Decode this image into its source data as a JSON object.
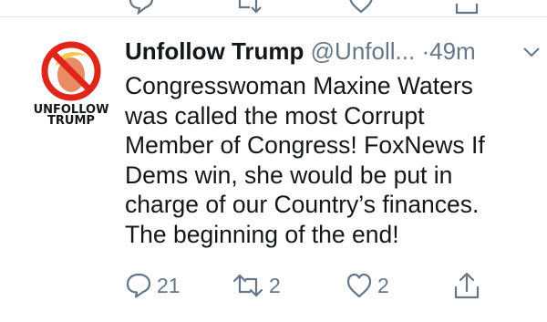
{
  "tweet": {
    "author_name": "Unfollow Trump",
    "handle": "@Unfoll...",
    "separator": "·",
    "time": "49m",
    "avatar_text_line1": "UNFOLLOW",
    "avatar_text_line2": "TRUMP",
    "text": "Congresswoman Maxine Waters\nwas called the most Corrupt\nMember of Congress! FoxNews If\nDems win, she would be put in\ncharge of our Country’s finances.\nThe beginning of the end!"
  },
  "actions": {
    "reply_count": "21",
    "retweet_count": "2",
    "like_count": "2"
  },
  "colors": {
    "text": "#14171a",
    "secondary": "#657786",
    "divider": "#e1e8ed",
    "no_sign_red": "#e0261b"
  },
  "icons": [
    "reply-icon",
    "retweet-icon",
    "like-icon",
    "share-icon",
    "chevron-down-icon"
  ]
}
